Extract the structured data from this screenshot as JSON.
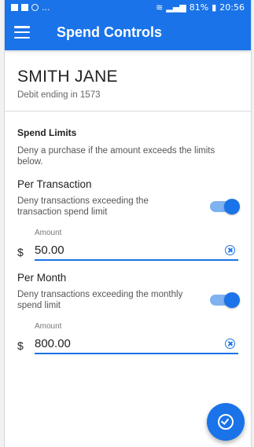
{
  "status_bar": {
    "left_ellipsis": "...",
    "battery": "81%",
    "time": "20:56"
  },
  "app_bar": {
    "title": "Spend Controls"
  },
  "account": {
    "name": "SMITH JANE",
    "subtitle": "Debit ending in 1573"
  },
  "spend_limits": {
    "title": "Spend Limits",
    "description": "Deny a purchase if the amount exceeds the limits below."
  },
  "per_transaction": {
    "heading": "Per Transaction",
    "description": "Deny transactions exceeding the transaction spend limit",
    "enabled": true,
    "amount_label": "Amount",
    "currency": "$",
    "amount": "50.00"
  },
  "per_month": {
    "heading": "Per Month",
    "description": "Deny transactions exceeding the monthly spend limit",
    "enabled": true,
    "amount_label": "Amount",
    "currency": "$",
    "amount": "800.00"
  },
  "colors": {
    "primary": "#1a73e8",
    "toggle_track": "#7fb2f0"
  }
}
